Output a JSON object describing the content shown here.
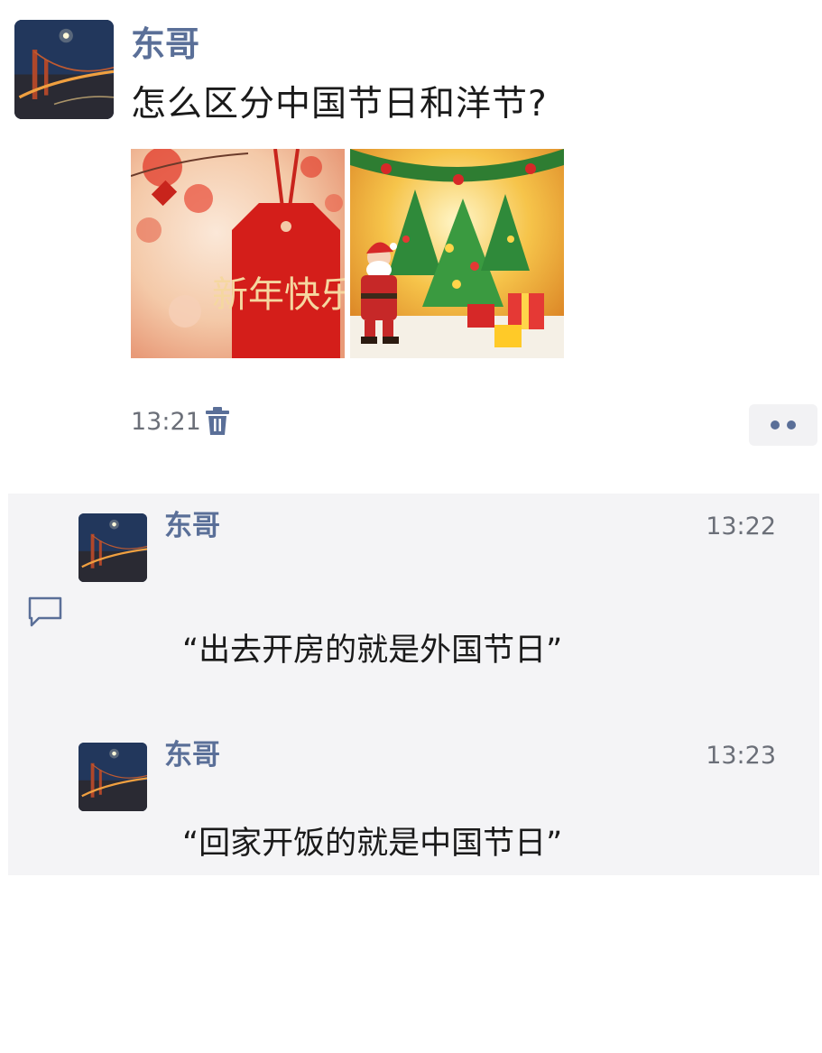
{
  "post": {
    "author": "东哥",
    "text": "怎么区分中国节日和洋节?",
    "images": [
      {
        "icon": "chinese-new-year-image",
        "caption": "新年快乐"
      },
      {
        "icon": "christmas-santa-image"
      }
    ],
    "time": "13:21",
    "delete_icon": "trash-icon",
    "more_icon": "more-dots-icon"
  },
  "comments": [
    {
      "author": "东哥",
      "time": "13:22",
      "text": "“出去开房的就是外国节日”"
    },
    {
      "author": "东哥",
      "time": "13:23",
      "text": "“回家开饭的就是中国节日”"
    }
  ],
  "comment_section_icon": "comment-bubble-icon",
  "colors": {
    "name_link": "#5a6f98",
    "text": "#1a1a1a",
    "meta": "#6b6f78",
    "comment_bg": "#f4f4f6"
  }
}
